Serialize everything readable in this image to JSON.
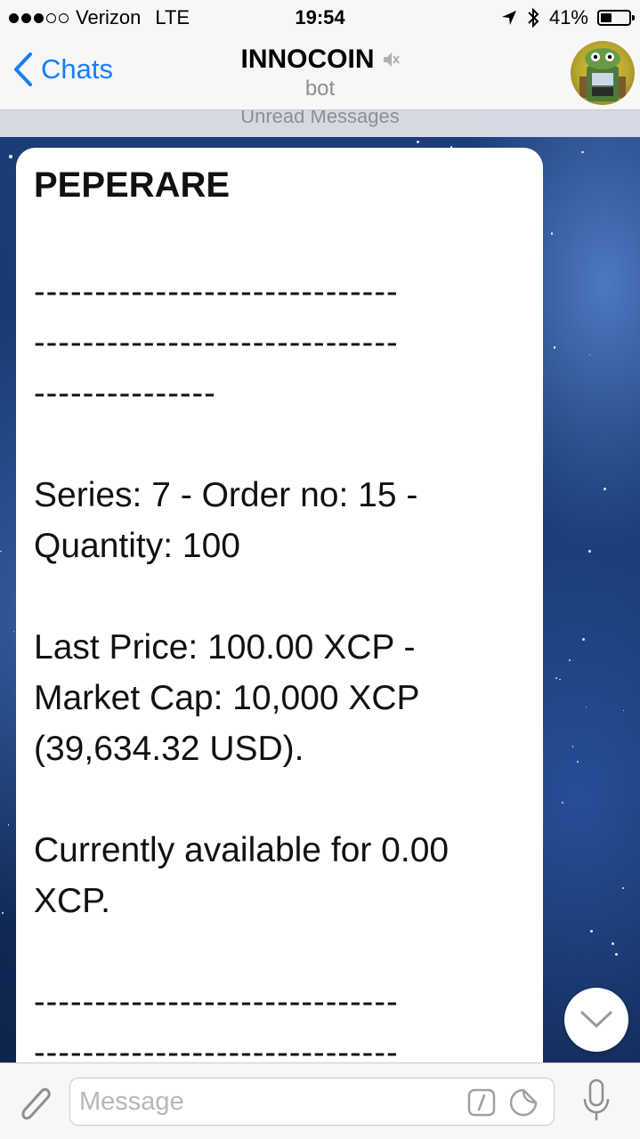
{
  "status_bar": {
    "carrier": "Verizon",
    "network": "LTE",
    "time": "19:54",
    "battery": "41%",
    "battery_level": 0.41
  },
  "header": {
    "back_label": "Chats",
    "title": "INNOCOIN",
    "subtitle": "bot",
    "muted": true,
    "avatar_icon": "innocoin-bot-avatar"
  },
  "chat": {
    "unread_banner": "Unread Messages",
    "message": {
      "title": "PEPERARE",
      "separator_1": [
        "------------------------------",
        "------------------------------",
        "---------------"
      ],
      "series_line": "Series: 7 - Order no: 15 -",
      "quantity_line": "Quantity: 100",
      "price_line": "Last Price: 100.00 XCP -",
      "market_cap_line": "Market Cap: 10,000 XCP",
      "usd_line": "(39,634.32 USD).",
      "availability_line_1": "Currently available for 0.00",
      "availability_line_2": "XCP.",
      "separator_2": [
        "------------------------------",
        "------------------------------"
      ]
    }
  },
  "composer": {
    "placeholder": "Message",
    "icons": [
      "paperclip-icon",
      "bot-command-icon",
      "sticker-icon",
      "microphone-icon"
    ]
  },
  "colors": {
    "accent": "#157efb",
    "bubble": "#ffffff",
    "bar": "#f7f7f7"
  }
}
